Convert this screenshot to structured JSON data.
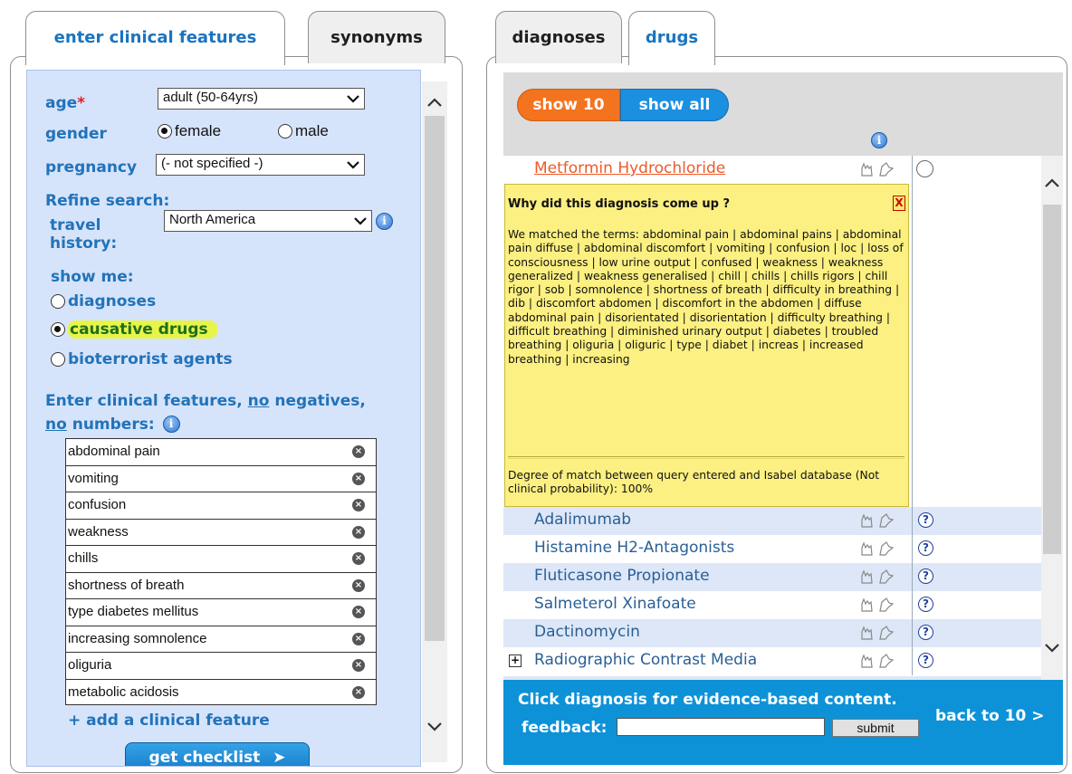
{
  "left_tabs": [
    {
      "label": "enter clinical features",
      "active": true
    },
    {
      "label": "synonyms",
      "active": false
    }
  ],
  "right_tabs": [
    {
      "label": "diagnoses",
      "active": false
    },
    {
      "label": "drugs",
      "active": true
    }
  ],
  "form": {
    "age_label": "age",
    "age_required_mark": "*",
    "age_value": "adult (50-64yrs)",
    "gender_label": "gender",
    "gender_options": [
      {
        "label": "female",
        "selected": true
      },
      {
        "label": "male",
        "selected": false
      }
    ],
    "pregnancy_label": "pregnancy",
    "pregnancy_value": "(- not specified -)",
    "refine_label": "Refine search:",
    "travel_label_1": "travel",
    "travel_label_2": "history:",
    "travel_value": "North America",
    "show_me_label": "show me:",
    "show_options": [
      {
        "label": "diagnoses",
        "selected": false
      },
      {
        "label": "causative drugs",
        "selected": true
      },
      {
        "label": "bioterrorist agents",
        "selected": false
      }
    ],
    "features_heading_1": "Enter clinical features, ",
    "features_no_1": "no",
    "features_heading_2": " negatives,",
    "features_no_2": "no",
    "features_heading_3": " numbers:",
    "features": [
      "abdominal pain",
      "vomiting",
      "confusion",
      "weakness",
      "chills",
      "shortness of breath",
      "type   diabetes mellitus",
      "increasing somnolence",
      "oliguria",
      "metabolic acidosis"
    ],
    "add_feature": "+ add a clinical feature",
    "checklist_button": "get checklist"
  },
  "results": {
    "show_10": "show 10",
    "show_all": "show all",
    "first_drug": "Metformin Hydrochloride",
    "popup": {
      "title": "Why did this diagnosis come up ?",
      "close": "X",
      "matched_terms": "We matched the terms: abdominal pain | abdominal pains | abdominal pain diffuse | abdominal discomfort | vomiting | confusion | loc | loss of consciousness | low urine output | confused | weakness | weakness generalized | weakness generalised | chill | chills | chills rigors | chill rigor | sob | somnolence | shortness of breath | difficulty in breathing | dib | discomfort abdomen | discomfort in the abdomen | diffuse abdominal pain | disorientated | disorientation | difficulty breathing | difficult breathing | diminished urinary output | diabetes | troubled breathing | oliguria | oliguric | type | diabet | increas | increased breathing | increasing",
      "degree": "Degree of match between query entered and Isabel database (Not clinical probability): 100%"
    },
    "drugs": [
      {
        "name": "Adalimumab",
        "expandable": false
      },
      {
        "name": "Histamine H2-Antagonists",
        "expandable": false
      },
      {
        "name": "Fluticasone Propionate",
        "expandable": false
      },
      {
        "name": "Salmeterol Xinafoate",
        "expandable": false
      },
      {
        "name": "Dactinomycin",
        "expandable": false
      },
      {
        "name": "Radiographic Contrast Media",
        "expandable": true
      }
    ],
    "footer_text": "Click diagnosis for evidence-based content.",
    "feedback_label": "feedback:",
    "submit_label": "submit",
    "back_label": "back to 10 >"
  },
  "colors": {
    "accent_blue": "#2273b9",
    "form_bg": "#d6e4fb",
    "highlight": "#e7f44a",
    "orange": "#f4731f",
    "footer_blue": "#0d92d8",
    "popup_yellow": "#fbf081"
  }
}
